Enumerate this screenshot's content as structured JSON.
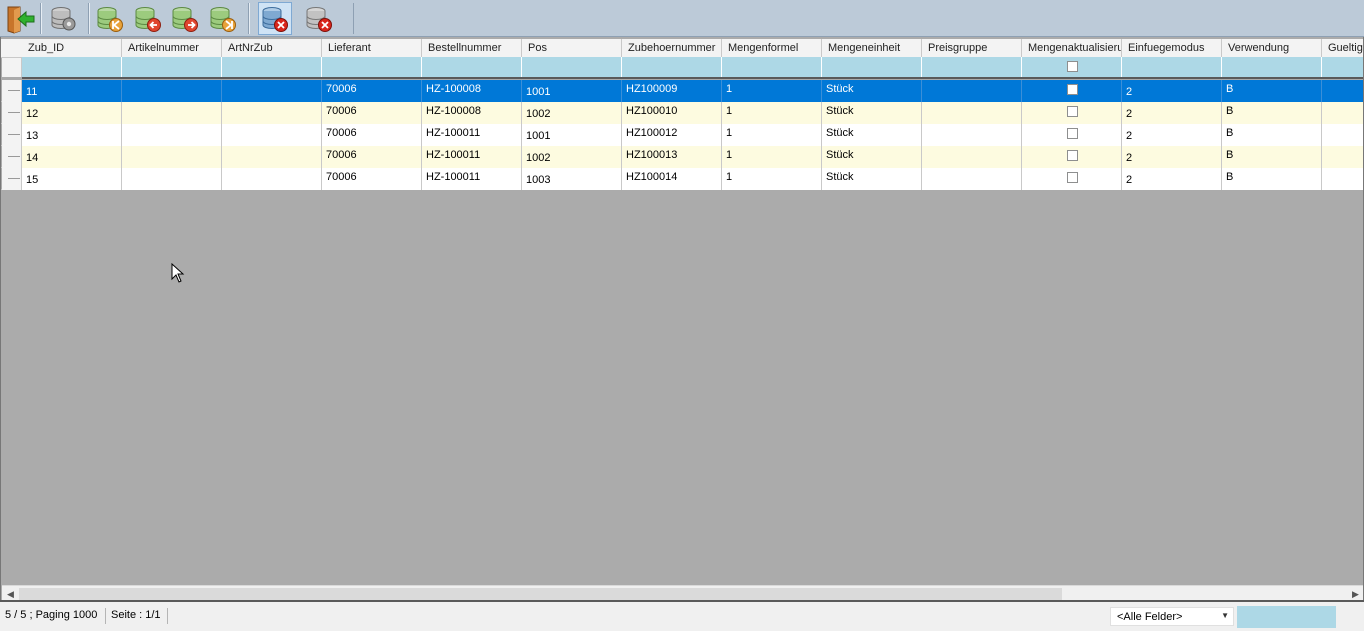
{
  "toolbar": {
    "buttons": [
      {
        "name": "exit-icon",
        "tooltip": ""
      },
      {
        "name": "database-settings-icon"
      },
      {
        "name": "database-first-icon"
      },
      {
        "name": "database-prev-icon"
      },
      {
        "name": "database-next-icon"
      },
      {
        "name": "database-last-icon"
      },
      {
        "name": "database-delete-filter-icon"
      },
      {
        "name": "database-delete-icon"
      }
    ]
  },
  "grid": {
    "columns": [
      "Zub_ID",
      "Artikelnummer",
      "ArtNrZub",
      "Lieferant",
      "Bestellnummer",
      "Pos",
      "Zubehoernummer",
      "Mengenformel",
      "Mengeneinheit",
      "Preisgruppe",
      "Mengenaktualisieru",
      "Einfuegemodus",
      "Verwendung",
      "Gueltig"
    ],
    "rows": [
      {
        "zub_id": "11",
        "artikelnummer": "",
        "artnrzub": "",
        "lieferant": "70006",
        "bestellnummer": "HZ-100008",
        "pos": "1001",
        "zubehoernummer": "HZ100009",
        "mengenformel": "1",
        "mengeneinheit": "Stück",
        "preisgruppe": "",
        "mengenaktualisierung": false,
        "einfuegemodus": "2",
        "verwendung": "B",
        "gueltig": ""
      },
      {
        "zub_id": "12",
        "artikelnummer": "",
        "artnrzub": "",
        "lieferant": "70006",
        "bestellnummer": "HZ-100008",
        "pos": "1002",
        "zubehoernummer": "HZ100010",
        "mengenformel": "1",
        "mengeneinheit": "Stück",
        "preisgruppe": "",
        "mengenaktualisierung": false,
        "einfuegemodus": "2",
        "verwendung": "B",
        "gueltig": ""
      },
      {
        "zub_id": "13",
        "artikelnummer": "",
        "artnrzub": "",
        "lieferant": "70006",
        "bestellnummer": "HZ-100011",
        "pos": "1001",
        "zubehoernummer": "HZ100012",
        "mengenformel": "1",
        "mengeneinheit": "Stück",
        "preisgruppe": "",
        "mengenaktualisierung": false,
        "einfuegemodus": "2",
        "verwendung": "B",
        "gueltig": ""
      },
      {
        "zub_id": "14",
        "artikelnummer": "",
        "artnrzub": "",
        "lieferant": "70006",
        "bestellnummer": "HZ-100011",
        "pos": "1002",
        "zubehoernummer": "HZ100013",
        "mengenformel": "1",
        "mengeneinheit": "Stück",
        "preisgruppe": "",
        "mengenaktualisierung": false,
        "einfuegemodus": "2",
        "verwendung": "B",
        "gueltig": ""
      },
      {
        "zub_id": "15",
        "artikelnummer": "",
        "artnrzub": "",
        "lieferant": "70006",
        "bestellnummer": "HZ-100011",
        "pos": "1003",
        "zubehoernummer": "HZ100014",
        "mengenformel": "1",
        "mengeneinheit": "Stück",
        "preisgruppe": "",
        "mengenaktualisierung": false,
        "einfuegemodus": "2",
        "verwendung": "B",
        "gueltig": ""
      }
    ],
    "selected_row": 0
  },
  "status": {
    "count": "5 / 5 ; Paging 1000",
    "page": "Seite : 1/1",
    "field_filter": "<Alle Felder>"
  },
  "colors": {
    "toolbar_bg": "#bccad8",
    "filter_bg": "#add8e6",
    "selected_bg": "#0078d7",
    "even_row_bg": "#fdfbe0",
    "grid_bg": "#ababab"
  }
}
